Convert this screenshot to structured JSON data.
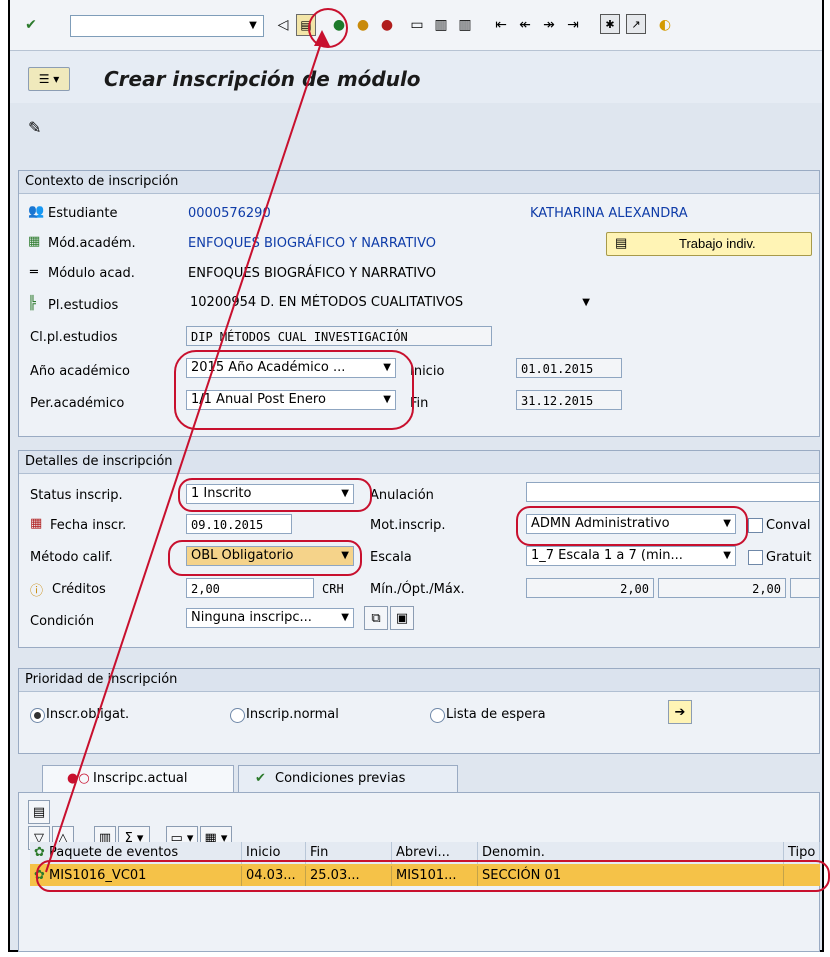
{
  "toolbar": {
    "command_field_value": "",
    "icons": [
      "enter-icon",
      "back-icon",
      "save-icon",
      "back-green-icon",
      "exit-icon",
      "cancel-icon",
      "print-icon",
      "find-icon",
      "find-next-icon",
      "first-page-icon",
      "prev-page-icon",
      "next-page-icon",
      "last-page-icon",
      "new-session-icon",
      "shortcut-icon",
      "help-icon"
    ]
  },
  "title": {
    "text": "Crear inscripción de módulo"
  },
  "contexto": {
    "header": "Contexto de inscripción",
    "estudiante_label": "Estudiante",
    "estudiante_id": "0000576290",
    "estudiante_name_suffix": "KATHARINA ALEXANDRA",
    "mod_academ_label": "Mód.académ.",
    "mod_academ_value": "ENFOQUES BIOGRÁFICO Y NARRATIVO",
    "trabajo_indiv_button": "Trabajo indiv.",
    "modulo_acad_label": "Módulo acad.",
    "modulo_acad_value": "ENFOQUES BIOGRÁFICO Y NARRATIVO",
    "pl_estudios_label": "Pl.estudios",
    "pl_estudios_value": "10200954 D. EN MÉTODOS CUALITATIVOS",
    "cl_pl_estudios_label": "Cl.pl.estudios",
    "cl_pl_estudios_value": "DIP MÉTODOS CUAL INVESTIGACIÓN",
    "anio_label": "Año académico",
    "anio_value": "2015 Año Académico ...",
    "inicio_label": "Inicio",
    "inicio_value": "01.01.2015",
    "per_label": "Per.académico",
    "per_value": "1/1 Anual Post Enero",
    "fin_label": "Fin",
    "fin_value": "31.12.2015"
  },
  "detalles": {
    "header": "Detalles de inscripción",
    "status_label": "Status inscrip.",
    "status_value": "1 Inscrito",
    "anulacion_label": "Anulación",
    "anulacion_value": "",
    "fecha_label": "Fecha inscr.",
    "fecha_value": "09.10.2015",
    "mot_label": "Mot.inscrip.",
    "mot_value": "ADMN Administrativo",
    "conval_label": "Conval",
    "metodo_label": "Método calif.",
    "metodo_value": "OBL Obligatorio",
    "escala_label": "Escala",
    "escala_value": "1_7 Escala 1 a 7 (min...",
    "gratuit_label": "Gratuit",
    "creditos_label": "Créditos",
    "creditos_value": "2,00",
    "creditos_unit": "CRH",
    "minoptmax_label": "Mín./Ópt./Máx.",
    "min_value": "2,00",
    "opt_value": "2,00",
    "condicion_label": "Condición",
    "condicion_value": "Ninguna inscripc..."
  },
  "prioridad": {
    "header": "Prioridad de inscripción",
    "opt1": "Inscr.obligat.",
    "opt2": "Inscrip.normal",
    "opt3": "Lista de espera"
  },
  "tabs": {
    "tab1": "Inscripc.actual",
    "tab2": "Condiciones previas"
  },
  "table": {
    "headers": [
      "Paquete de eventos",
      "Inicio",
      "Fin",
      "Abrevi...",
      "Denomin.",
      "Tipo"
    ],
    "row": [
      "MIS1016_VC01",
      "04.03...",
      "25.03...",
      "MIS101...",
      "SECCIÓN 01"
    ]
  }
}
